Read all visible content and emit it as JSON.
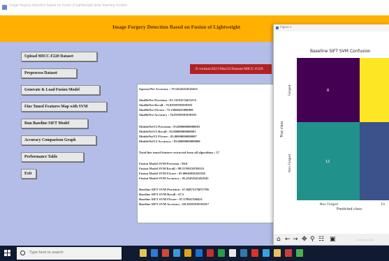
{
  "window": {
    "title": "Image forgery detection based on fusion of lightweight deep learning models"
  },
  "banner": {
    "title": "Image Forgery Detection Based on Fusion of Lightweight"
  },
  "sidebar": {
    "buttons": [
      {
        "label": "Upload MICC-F220 Dataset"
      },
      {
        "label": "Preprocess Dataset"
      },
      {
        "label": "Generate & Load Fusion Model"
      },
      {
        "label": "Fine Tuned Features Map with SVM"
      },
      {
        "label": "Run Baseline SIFT Model"
      },
      {
        "label": "Accuracy Comparison Graph"
      },
      {
        "label": "Performance Table"
      },
      {
        "label": "Exit"
      }
    ]
  },
  "path_label": "E:/venkat/2021/Mar22/Dataset/MICC-F220",
  "output": {
    "lines": [
      "SqueezeNet Accuracy : 79.54545454545455",
      "ShuffleNet Precision : 81.74193274433274",
      "ShuffleNet Recall : 76.93939393939393",
      "ShuffleNet FScore : 75.23968435990099",
      "ShuffleNet Accuracy : 76.93939393939393",
      "MobileNetV2 Precision : 83.00000000000003",
      "MobileNetV2 Recall : 83.00000000000001",
      "MobileNetV2 FScore : 83.00000000000007",
      "MobileNetV2 Accuracy : 83.00000000000000",
      "Total fine tuned features extracted from all algorithms : 57",
      "Fusion Model SVM Precision : 99.0",
      "Fusion Model SVM Recall : 98.55769230769231",
      "Fusion Model SVM FScore : 95.00602805203339",
      "Fusion Model SVM Accuracy : 95.45454545454545",
      "Baseline SIFT SVM Precision : 67.04873176071796",
      "Baseline SIFT SVM Recall : 67.5",
      "Baseline SIFT SVM FScore : 67.578947368421",
      "Baseline SIFT SVM Accuracy : 68.18181818181817"
    ]
  },
  "figure": {
    "window_title": "Figure 1",
    "chart_data": {
      "type": "heatmap",
      "title": "Baseline SIFT SVM Confusion",
      "xlabel": "Predicted class",
      "ylabel": "True class",
      "x_ticks": [
        "Non Forged",
        "Fo"
      ],
      "y_ticks": [
        "Forged",
        "Non Forged"
      ],
      "cells": [
        {
          "row": 0,
          "col": 0,
          "value": "8",
          "color": "#440154"
        },
        {
          "row": 0,
          "col": 1,
          "value": "",
          "color": "#fde725"
        },
        {
          "row": 1,
          "col": 0,
          "value": "12",
          "color": "#21918c"
        },
        {
          "row": 1,
          "col": 1,
          "value": "",
          "color": "#3b528b"
        }
      ]
    },
    "toolbar": {
      "home": "⌂",
      "back": "←",
      "forward": "→",
      "pan": "✥",
      "zoom": "⚲",
      "config": "☷",
      "save": "▣",
      "coords_hint": "x=0.62 y=0.04"
    }
  },
  "taskbar": {
    "search_placeholder": "Type here to search"
  },
  "colors": {
    "banner": "#ffb000",
    "canvas": "#b3bde8",
    "path_label_bg": "#b22222",
    "taskbar": "#101a30"
  }
}
